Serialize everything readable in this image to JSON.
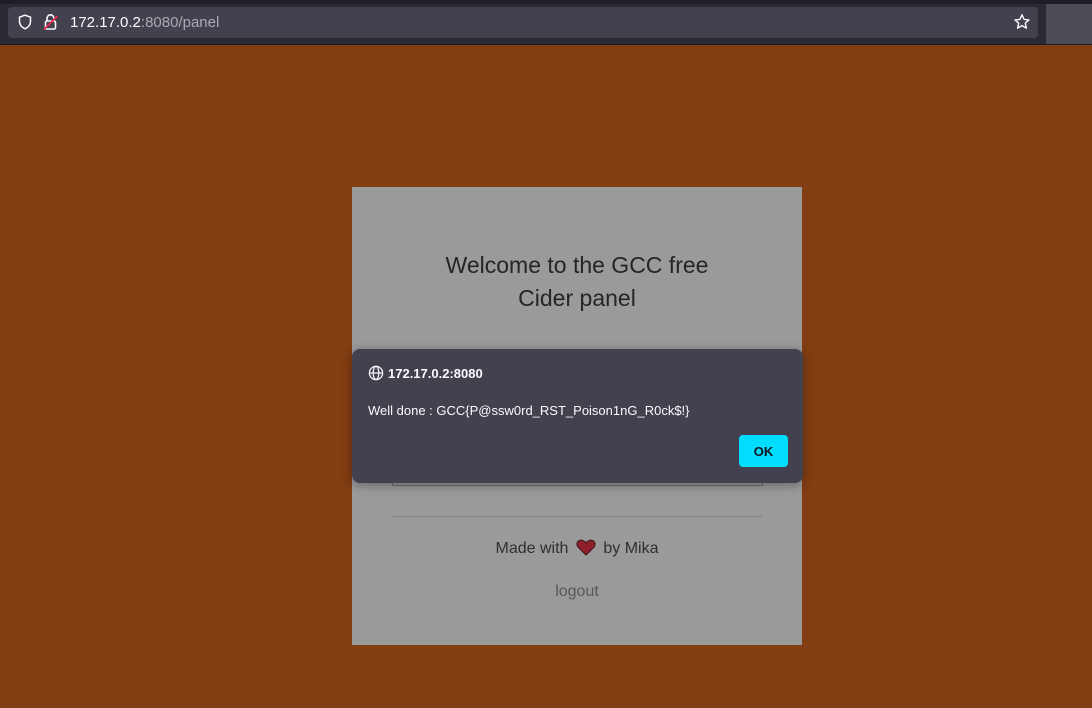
{
  "browser": {
    "url_host": "172.17.0.2",
    "url_rest": ":8080/panel",
    "icons": [
      "shield-icon",
      "lock-icon",
      "star-icon"
    ]
  },
  "page": {
    "background_color": "#823d12",
    "title_line1": "Welcome to the GCC free",
    "title_line2": "Cider panel",
    "made_with_prefix": "Made with",
    "made_with_suffix": "by Mika",
    "logout_label": "logout"
  },
  "dialog": {
    "origin": "172.17.0.2:8080",
    "message": "Well done : GCC{P@ssw0rd_RST_Poison1nG_R0ck$!}",
    "ok_label": "OK",
    "accent_color": "#00ddff"
  }
}
